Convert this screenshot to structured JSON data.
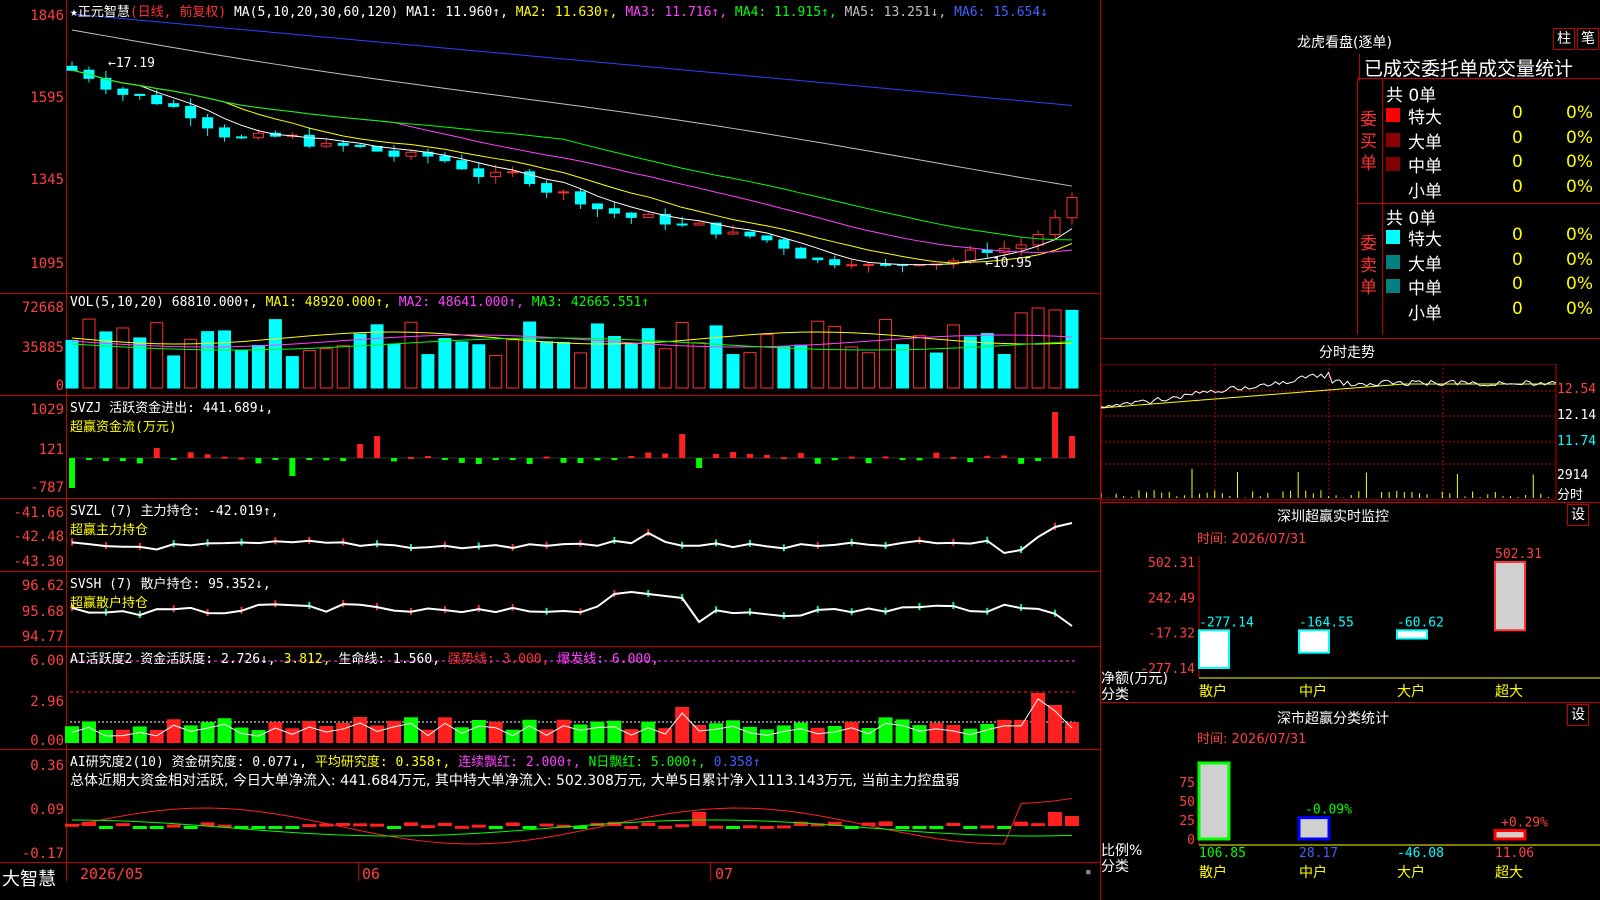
{
  "window": {
    "brand": "大智慧"
  },
  "kline": {
    "star": "★",
    "stock_name": "正元智慧",
    "mode": "(日线, 前复权)",
    "ma_header": "MA(5,10,20,30,60,120)",
    "ma1": "MA1: 11.960↑,",
    "ma2": "MA2: 11.630↑,",
    "ma3": "MA3: 11.716↑,",
    "ma4": "MA4: 11.915↑,",
    "ma5": "MA5: 13.251↓,",
    "ma6": "MA6: 15.654↓",
    "y_ticks": [
      "1846",
      "1595",
      "1345",
      "1095"
    ],
    "high_label": "17.19",
    "low_label": "10.95",
    "colors": {
      "up": "#ff3030",
      "down": "#00ffff",
      "ma1": "#ffffff",
      "ma2": "#ffff00",
      "ma3": "#ff40ff",
      "ma4": "#00ff00",
      "ma5": "#c0c0c0",
      "ma6": "#3040ff"
    }
  },
  "vol": {
    "title": "VOL(5,10,20)",
    "value": "68810.000↑,",
    "ma1": "MA1: 48920.000↑,",
    "ma2": "MA2: 48641.000↑,",
    "ma3": "MA3: 42665.551↑",
    "y_ticks": [
      "72668",
      "35885",
      "0"
    ]
  },
  "svzj": {
    "title": "SVZJ  活跃资金进出: 441.689↓,",
    "subtitle": "超赢资金流(万元)",
    "y_ticks": [
      "1029",
      "121",
      "-787"
    ]
  },
  "svzl": {
    "title": "SVZL (7) 主力持仓: -42.019↑,",
    "subtitle": "超赢主力持仓",
    "y_ticks": [
      "-41.66",
      "-42.48",
      "-43.30"
    ]
  },
  "svsh": {
    "title": "SVSH (7) 散户持仓: 95.352↓,",
    "subtitle": "超赢散户持仓",
    "y_ticks": [
      "96.62",
      "95.68",
      "94.77"
    ]
  },
  "ai_active": {
    "title": "AI活跃度2 资金活跃度: 2.726↓,",
    "v2": "3.812,",
    "life": "生命线: 1.560,",
    "strong": "强势线: 3.000,",
    "burst": "爆发线: 6.000,",
    "y_ticks": [
      "6.00",
      "2.96",
      "0.00"
    ]
  },
  "ai_research": {
    "title": "AI研究度2(10) 资金研究度: 0.077↓,",
    "avg": "平均研究度: 0.358↑,",
    "cont": "连续飘红: 2.000↑,",
    "nday": "N日飘红: 5.000↑,",
    "last": "0.358↑",
    "summary": "总体近期大资金相对活跃, 今日大单净流入: 441.684万元, 其中特大单净流入: 502.308万元, 大单5日累计净入1113.143万元, 当前主力控盘弱",
    "y_ticks": [
      "0.36",
      "0.09",
      "-0.17"
    ]
  },
  "xaxis": {
    "labels": [
      "2026/05",
      "06",
      "07"
    ]
  },
  "dragon": {
    "title": "龙虎看盘(逐单)",
    "btn_bar": "柱",
    "btn_pen": "笔",
    "tabs": "已成交委托单成交量统计",
    "buy_label": "委买单",
    "sell_label": "委卖单",
    "buy_total": "共 0单",
    "sell_total": "共 0单",
    "buy_rows": [
      {
        "name": "特大",
        "count": "0",
        "pct": "0%",
        "color": "#ff0000"
      },
      {
        "name": "大单",
        "count": "0",
        "pct": "0%",
        "color": "#8b0000"
      },
      {
        "name": "中单",
        "count": "0",
        "pct": "0%",
        "color": "#800000"
      },
      {
        "name": "小单",
        "count": "0",
        "pct": "0%",
        "color": "#000000"
      }
    ],
    "sell_rows": [
      {
        "name": "特大",
        "count": "0",
        "pct": "0%",
        "color": "#00ffff"
      },
      {
        "name": "大单",
        "count": "0",
        "pct": "0%",
        "color": "#008080"
      },
      {
        "name": "中单",
        "count": "0",
        "pct": "0%",
        "color": "#008080"
      },
      {
        "name": "小单",
        "count": "0",
        "pct": "0%",
        "color": "#000000"
      }
    ]
  },
  "intraday": {
    "title": "分时走势",
    "y_ticks": [
      "12.54",
      "12.14",
      "11.74",
      "2914",
      "分时"
    ]
  },
  "sz_monitor": {
    "title": "深圳超赢实时监控",
    "btn": "设",
    "time": "时间: 2026/07/31",
    "y_ticks": [
      "502.31",
      "242.49",
      "-17.32",
      "-277.14"
    ],
    "ylabel": "净额(万元)",
    "xlabel": "分类",
    "categories": [
      "散户",
      "中户",
      "大户",
      "超大"
    ],
    "values": [
      "-277.14",
      "-164.55",
      "-60.62",
      "502.31"
    ]
  },
  "sz_stats": {
    "title": "深市超赢分类统计",
    "btn": "设",
    "time": "时间: 2026/07/31",
    "y_ticks": [
      "75",
      "50",
      "25",
      "0"
    ],
    "ylabel": "比例%",
    "xlabel": "分类",
    "categories": [
      "散户",
      "中户",
      "大户",
      "超大"
    ],
    "values": [
      "106.85",
      "28.17",
      "-46.08",
      "11.06"
    ],
    "changes": [
      "",
      "-0.09%",
      "",
      "+0.29%"
    ]
  },
  "chart_data": {
    "type": "bar",
    "title": "深圳超赢实时监控",
    "categories": [
      "散户",
      "中户",
      "大户",
      "超大"
    ],
    "values": [
      -277.14,
      -164.55,
      -60.62,
      502.31
    ],
    "xlabel": "分类",
    "ylabel": "净额(万元)",
    "ylim": [
      -277.14,
      502.31
    ]
  }
}
